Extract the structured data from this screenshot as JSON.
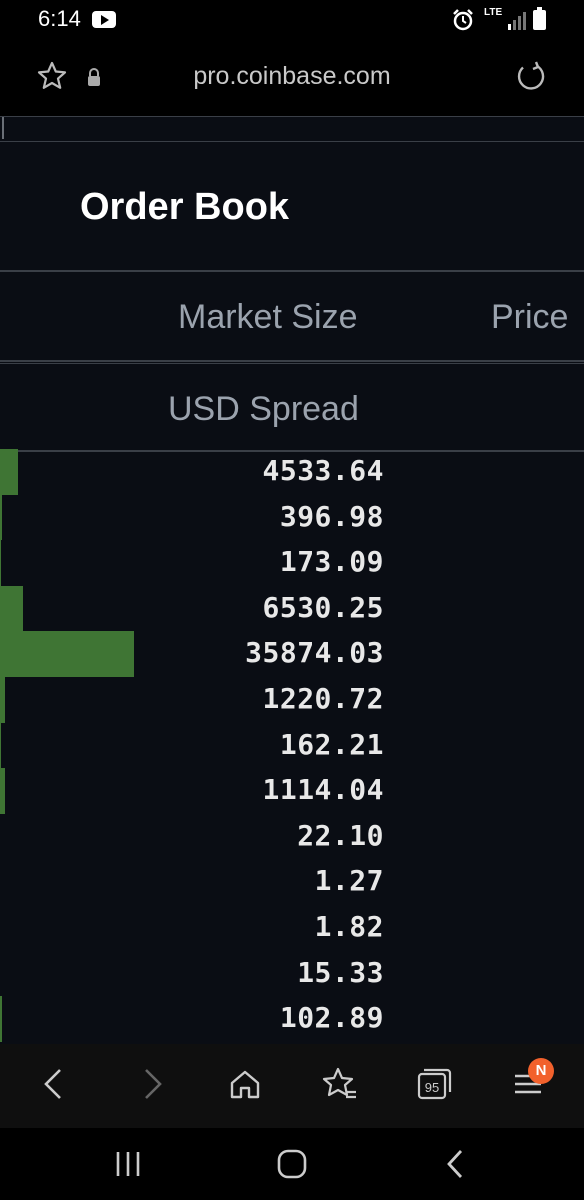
{
  "status_bar": {
    "time": "6:14",
    "network": "LTE",
    "icons": [
      "youtube-icon",
      "alarm-icon",
      "signal-icon",
      "battery-icon"
    ]
  },
  "browser": {
    "url": "pro.coinbase.com",
    "icons": [
      "star-icon",
      "lock-icon",
      "reload-icon"
    ]
  },
  "order_book": {
    "title": "Order Book",
    "headers": {
      "market_size": "Market Size",
      "price": "Price"
    },
    "spread_label": "USD Spread",
    "rows": [
      {
        "size": "4533.64",
        "depth": 0.03
      },
      {
        "size": "396.98",
        "depth": 0.004
      },
      {
        "size": "173.09",
        "depth": 0.002
      },
      {
        "size": "6530.25",
        "depth": 0.04
      },
      {
        "size": "35874.03",
        "depth": 0.23
      },
      {
        "size": "1220.72",
        "depth": 0.008
      },
      {
        "size": "162.21",
        "depth": 0.002
      },
      {
        "size": "1114.04",
        "depth": 0.008
      },
      {
        "size": "22.10",
        "depth": 0
      },
      {
        "size": "1.27",
        "depth": 0
      },
      {
        "size": "1.82",
        "depth": 0
      },
      {
        "size": "15.33",
        "depth": 0
      },
      {
        "size": "102.89",
        "depth": 0.003
      }
    ],
    "colors": {
      "bid_bar": "#3f7534",
      "background": "#0a0d14",
      "header_text": "#9ba3ae"
    }
  },
  "browser_nav": {
    "tab_count": "95",
    "notification_badge": "N",
    "icons": [
      "back-icon",
      "forward-icon",
      "home-icon",
      "bookmarks-icon",
      "tabs-icon",
      "menu-icon"
    ]
  },
  "system_nav": {
    "icons": [
      "recent-apps-icon",
      "home-icon",
      "back-icon"
    ]
  }
}
